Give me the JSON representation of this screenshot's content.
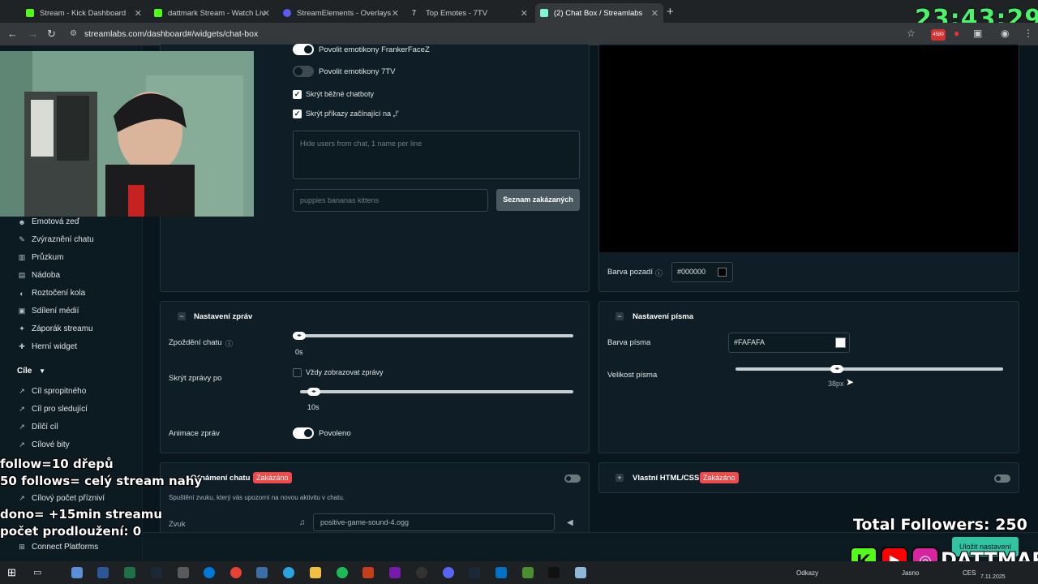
{
  "browser": {
    "tabs": [
      {
        "title": "Stream - Kick Dashboard",
        "color": "#53fc18"
      },
      {
        "title": "dattmark Stream - Watch Live o",
        "color": "#53fc18"
      },
      {
        "title": "StreamElements - Overlays",
        "color": "#5b5bf5"
      },
      {
        "title": "Top Emotes - 7TV",
        "color": "#ffffff"
      },
      {
        "title": "(2) Chat Box / Streamlabs",
        "color": "#80f5d2"
      }
    ],
    "url": "streamlabs.com/dashboard#/widgets/chat-box",
    "extension_badge": "4580"
  },
  "clock": "23:43:29",
  "sidebar": {
    "items_top": [
      {
        "label": "Emotová zeď",
        "icon": "emote-icon"
      },
      {
        "label": "Zvýraznění chatu",
        "icon": "highlight-icon"
      },
      {
        "label": "Průzkum",
        "icon": "poll-icon"
      },
      {
        "label": "Nádoba",
        "icon": "jar-icon"
      },
      {
        "label": "Roztočení kola",
        "icon": "wheel-icon"
      },
      {
        "label": "Sdílení médií",
        "icon": "media-icon"
      },
      {
        "label": "Záporák streamu",
        "icon": "villain-icon"
      },
      {
        "label": "Herní widget",
        "icon": "game-icon"
      }
    ],
    "section_goals": "Cíle",
    "items_goals": [
      {
        "label": "Cíl spropitného",
        "icon": "tip-goal-icon"
      },
      {
        "label": "Cíl pro sledující",
        "icon": "follower-goal-icon"
      },
      {
        "label": "Dílčí cíl",
        "icon": "sub-goal-icon"
      },
      {
        "label": "Cílové bity",
        "icon": "bits-goal-icon"
      },
      {
        "label": "Cílový počet přízniví",
        "icon": "supporter-goal-icon"
      }
    ],
    "connect": "Connect Platforms"
  },
  "chat_settings": {
    "frankerfacez": "Povolit emotikony FrankerFaceZ",
    "seventv": "Povolit emotikony 7TV",
    "hide_bots": "Skrýt běžné chatboty",
    "hide_commands": "Skrýt příkazy začínající na „!'",
    "hide_users_placeholder": "Hide users from chat, 1 name per line",
    "banned_words_placeholder": "puppies bananas kittens",
    "banned_list_button": "Seznam zakázaných"
  },
  "preview": {
    "bg_label": "Barva pozadí",
    "bg_value": "#000000"
  },
  "messages": {
    "title": "Nastavení zpráv",
    "delay_label": "Zpoždění chatu",
    "delay_value": "0s",
    "delay_fraction": 0.0,
    "hide_after_label": "Skrýt zprávy po",
    "always_show": "Vždy zobrazovat zprávy",
    "hide_value": "10s",
    "hide_fraction": 0.05,
    "animation_label": "Animace zpráv",
    "animation_value": "Povoleno"
  },
  "font": {
    "title": "Nastavení písma",
    "color_label": "Barva písma",
    "color_value": "#FAFAFA",
    "size_label": "Velikost písma",
    "size_value": "38px",
    "size_fraction": 0.38
  },
  "alert": {
    "title": "Oznámení chatu",
    "status": "Zakázáno",
    "description": "Spuštění zvuku, který vás upozorní na novou aktivitu v chatu.",
    "sound_label": "Zvuk",
    "sound_file": "positive-game-sound-4.ogg"
  },
  "custom_css": {
    "title": "Vlastní HTML/CSS",
    "status": "Zakázáno"
  },
  "save_button": "Uložit nastavení",
  "overlays": {
    "follow_line": "follow=10 dřepů",
    "follows_line": "50 follows= celý stream nahý",
    "dono_line": "dono= +15min streamu",
    "extensions_line": "počet prodloužení: 0",
    "total_followers": "Total Followers: 250",
    "brand": "DATTMARK"
  },
  "taskbar": {
    "links": "Odkazy",
    "weather": "Jasno",
    "lang": "CES",
    "date": "7.11.2025"
  }
}
